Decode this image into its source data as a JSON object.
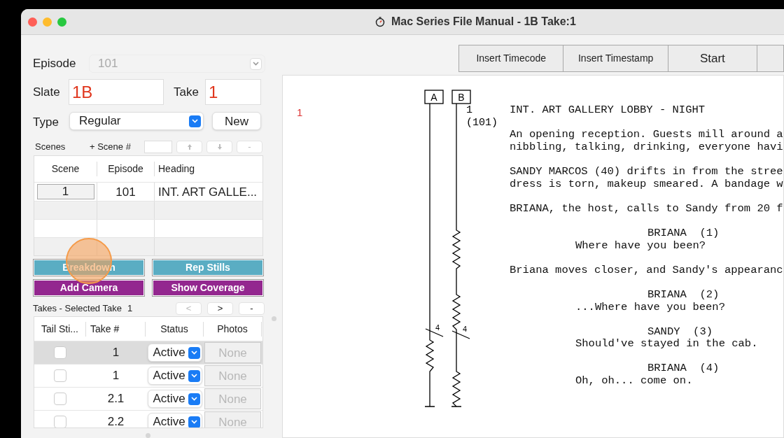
{
  "window": {
    "title": "Mac Series File Manual - 1B Take:1"
  },
  "form": {
    "episode": {
      "label": "Episode",
      "value": "101",
      "disabled": true
    },
    "slate": {
      "label": "Slate",
      "value": "1B"
    },
    "take": {
      "label": "Take",
      "value": "1"
    },
    "type": {
      "label": "Type",
      "value": "Regular"
    },
    "new_button": "New"
  },
  "scenes": {
    "label": "Scenes",
    "add_label": "+ Scene #",
    "buttons": [
      {
        "kind": "up",
        "disabled": true
      },
      {
        "kind": "down",
        "disabled": true
      },
      {
        "kind": "remove",
        "label": "-",
        "disabled": true
      }
    ],
    "columns": [
      "Scene",
      "Episode",
      "Heading"
    ],
    "rows": [
      {
        "scene": "1",
        "episode": "101",
        "heading": "INT. ART GALLE..."
      }
    ]
  },
  "action_buttons": [
    {
      "label": "Breakdown",
      "color": "#5aadc3"
    },
    {
      "label": "Rep Stills",
      "color": "#5aadc3"
    },
    {
      "label": "Add Camera",
      "color": "#93278f"
    },
    {
      "label": "Show Coverage",
      "color": "#93278f"
    }
  ],
  "takes": {
    "label": "Takes - Selected Take",
    "selected_take": "1",
    "nav": [
      {
        "label": "<",
        "disabled": true
      },
      {
        "label": ">",
        "disabled": false
      },
      {
        "label": "-",
        "disabled": false
      }
    ],
    "columns": [
      "Tail Sti...",
      "Take #",
      "Status",
      "Photos"
    ],
    "rows": [
      {
        "tail_stick": false,
        "take": "1",
        "status": "Active",
        "photos": "None",
        "selected": true
      },
      {
        "tail_stick": false,
        "take": "1",
        "status": "Active",
        "photos": "None",
        "selected": false
      },
      {
        "tail_stick": false,
        "take": "2.1",
        "status": "Active",
        "photos": "None",
        "selected": false
      },
      {
        "tail_stick": false,
        "take": "2.2",
        "status": "Active",
        "photos": "None",
        "selected": false
      }
    ]
  },
  "toolbar": [
    "Insert Timecode",
    "Insert Timestamp",
    "Start"
  ],
  "script": {
    "scene_number": "1",
    "scene_label": "1",
    "scene_episode": "(101)",
    "coverage": [
      {
        "label": "A",
        "mark": "4"
      },
      {
        "label": "B",
        "mark": "4"
      }
    ],
    "blocks": [
      {
        "kind": "heading",
        "lines": [
          "INT. ART GALLERY LOBBY - NIGHT"
        ]
      },
      {
        "kind": "action",
        "lines": [
          "An opening reception. Guests mill around a",
          "nibbling, talking, drinking, everyone havi"
        ]
      },
      {
        "kind": "action",
        "lines": [
          "SANDY MARCOS (40) drifts in from the stree",
          "dress is torn, makeup smeared. A bandage w"
        ]
      },
      {
        "kind": "action",
        "lines": [
          "BRIANA, the host, calls to Sandy from 20 f"
        ]
      },
      {
        "kind": "character",
        "lines": [
          "BRIANA  (1)"
        ]
      },
      {
        "kind": "dialogue",
        "lines": [
          "Where have you been?"
        ]
      },
      {
        "kind": "action",
        "lines": [
          "Briana moves closer, and Sandy's appearanc"
        ]
      },
      {
        "kind": "character",
        "lines": [
          "BRIANA  (2)"
        ]
      },
      {
        "kind": "dialogue",
        "lines": [
          "...Where have you been?"
        ]
      },
      {
        "kind": "character",
        "lines": [
          "SANDY  (3)"
        ]
      },
      {
        "kind": "dialogue",
        "lines": [
          "Should've stayed in the cab."
        ]
      },
      {
        "kind": "character",
        "lines": [
          "BRIANA  (4)"
        ]
      },
      {
        "kind": "dialogue",
        "lines": [
          "Oh, oh... come on."
        ]
      }
    ]
  }
}
